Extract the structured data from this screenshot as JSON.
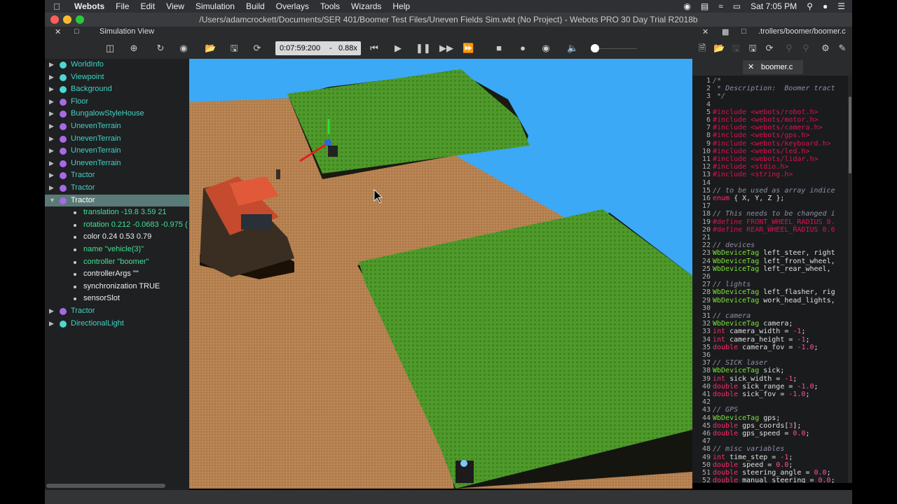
{
  "menubar": {
    "app": "Webots",
    "items": [
      "File",
      "Edit",
      "View",
      "Simulation",
      "Build",
      "Overlays",
      "Tools",
      "Wizards",
      "Help"
    ],
    "clock": "Sat 7:05 PM"
  },
  "window": {
    "title": "/Users/adamcrockett/Documents/SER 401/Boomer Test Files/Uneven Fields Sim.wbt (No Project) - Webots PRO 30 Day Trial R2018b"
  },
  "sim_panel": {
    "title": "Simulation View",
    "time": "0:07:59:200",
    "dash": "-",
    "speed": "0.88x"
  },
  "scene_tree": {
    "nodes_top": [
      {
        "label": "WorldInfo",
        "color": "#4fd6d0"
      },
      {
        "label": "Viewpoint",
        "color": "#4fd6d0"
      },
      {
        "label": "Background",
        "color": "#4fd6d0"
      },
      {
        "label": "Floor",
        "color": "#a76ae6"
      },
      {
        "label": "BungalowStyleHouse",
        "color": "#a76ae6"
      },
      {
        "label": "UnevenTerrain",
        "color": "#a76ae6"
      },
      {
        "label": "UnevenTerrain",
        "color": "#a76ae6"
      },
      {
        "label": "UnevenTerrain",
        "color": "#a76ae6"
      },
      {
        "label": "UnevenTerrain",
        "color": "#a76ae6"
      },
      {
        "label": "Tractor",
        "color": "#a76ae6"
      },
      {
        "label": "Tractor",
        "color": "#a76ae6"
      }
    ],
    "selected": {
      "label": "Tractor"
    },
    "fields": [
      "translation -19.8 3.59 21",
      "rotation 0.212 -0.0683 -0.975 (",
      "color 0.24 0.53 0.79",
      "name \"vehicle(3)\"",
      "controller \"boomer\"",
      "controllerArgs \"\"",
      "synchronization TRUE",
      "sensorSlot"
    ],
    "nodes_bottom": [
      {
        "label": "Tractor",
        "color": "#a76ae6"
      },
      {
        "label": "DirectionalLight",
        "color": "#4fd6d0"
      }
    ]
  },
  "editor": {
    "path": ".trollers/boomer/boomer.c",
    "tab": "boomer.c",
    "lines": [
      "/*",
      " * Description:  Boomer tract",
      " */",
      "",
      "#include <webots/robot.h>",
      "#include <webots/motor.h>",
      "#include <webots/camera.h>",
      "#include <webots/gps.h>",
      "#include <webots/keyboard.h>",
      "#include <webots/led.h>",
      "#include <webots/lidar.h>",
      "#include <stdio.h>",
      "#include <string.h>",
      "",
      "// to be used as array indice",
      "enum { X, Y, Z };",
      "",
      "// This needs to be changed i",
      "#define FRONT_WHEEL_RADIUS 0.",
      "#define REAR_WHEEL_RADIUS 0.6",
      "",
      "// devices",
      "WbDeviceTag left_steer, right",
      "WbDeviceTag left_front_wheel,",
      "WbDeviceTag left_rear_wheel, ",
      "",
      "// lights",
      "WbDeviceTag left_flasher, rig",
      "WbDeviceTag work_head_lights,",
      "",
      "// camera",
      "WbDeviceTag camera;",
      "int camera_width = -1;",
      "int camera_height = -1;",
      "double camera_fov = -1.0;",
      "",
      "// SICK laser",
      "WbDeviceTag sick;",
      "int sick_width = -1;",
      "double sick_range = -1.0;",
      "double sick_fov = -1.0;",
      "",
      "// GPS",
      "WbDeviceTag gps;",
      "double gps_coords[3];",
      "double gps_speed = 0.0;",
      "",
      "// misc variables",
      "int time_step = -1;",
      "double speed = 0.0;",
      "double steering_angle = 0.0;",
      "double manual_steering = 0.0;"
    ]
  }
}
